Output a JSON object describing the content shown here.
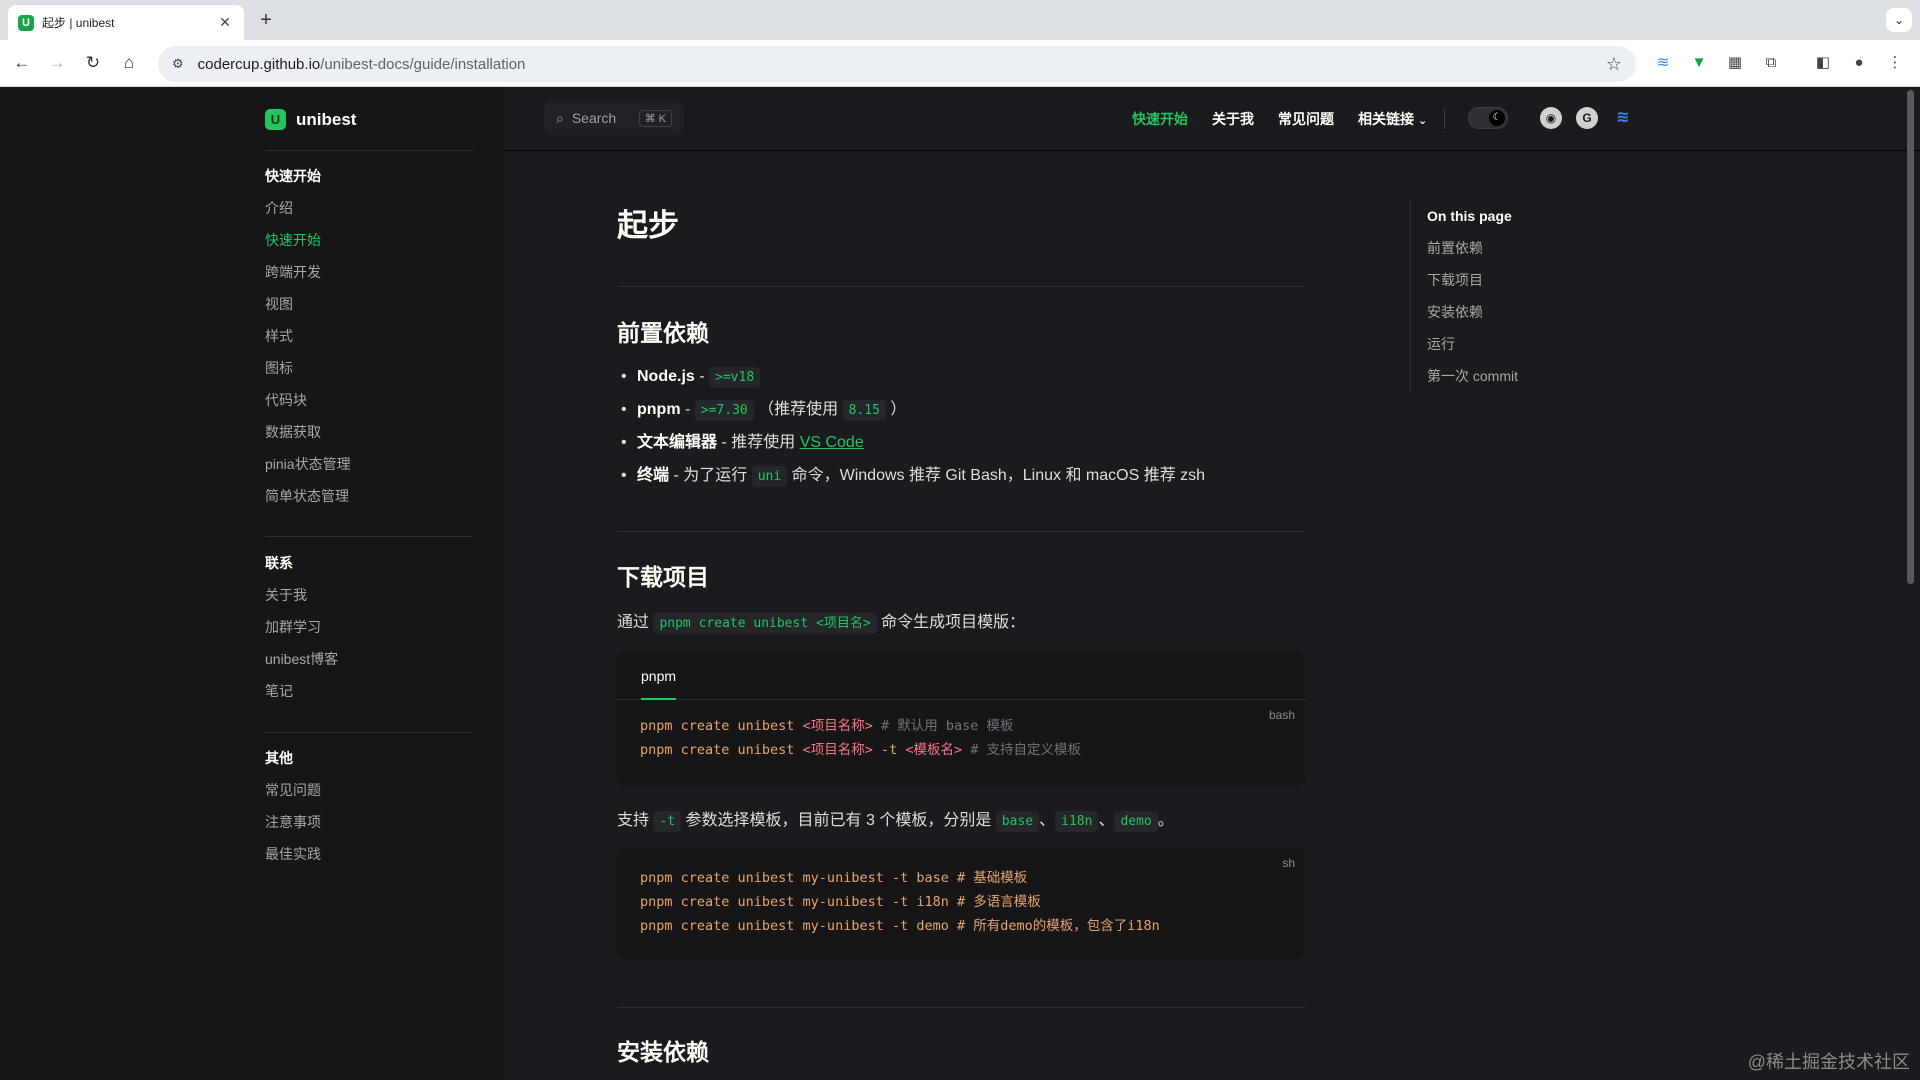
{
  "browser": {
    "tab_title": "起步 | unibest",
    "url_host": "codercup.github.io",
    "url_path": "/unibest-docs/guide/installation"
  },
  "sidebar": {
    "logo": "unibest",
    "groups": [
      {
        "title": "快速开始",
        "items": [
          "介绍",
          "快速开始",
          "跨端开发",
          "视图",
          "样式",
          "图标",
          "代码块",
          "数据获取",
          "pinia状态管理",
          "简单状态管理"
        ]
      },
      {
        "title": "联系",
        "items": [
          "关于我",
          "加群学习",
          "unibest博客",
          "笔记"
        ]
      },
      {
        "title": "其他",
        "items": [
          "常见问题",
          "注意事项",
          "最佳实践"
        ]
      }
    ],
    "active_item": "快速开始"
  },
  "topnav": {
    "search_label": "Search",
    "search_shortcut": "⌘ K",
    "links": [
      "快速开始",
      "关于我",
      "常见问题",
      "相关链接"
    ]
  },
  "main": {
    "title": "起步",
    "sec1": {
      "heading": "前置依赖",
      "b1_name": "Node.js",
      "b1_sep": " - ",
      "b1_code": ">=v18",
      "b2_name": "pnpm",
      "b2_sep": " - ",
      "b2_code": ">=7.30",
      "b2_mid": " （推荐使用 ",
      "b2_code2": "8.15",
      "b2_end": " ）",
      "b3_name": "文本编辑器",
      "b3_mid": " - 推荐使用 ",
      "b3_link": "VS Code",
      "b4_name": "终端",
      "b4_mid": " - 为了运行 ",
      "b4_code": "uni",
      "b4_end": " 命令，Windows 推荐 Git Bash，Linux 和 macOS 推荐 zsh"
    },
    "sec2": {
      "heading": "下载项目",
      "p1_pre": "通过 ",
      "p1_code": "pnpm create unibest <项目名>",
      "p1_post": " 命令生成项目模版：",
      "tab": "pnpm",
      "lang1": "bash",
      "code1_l1_cmd": "pnpm create unibest ",
      "code1_l1_ph": "<项目名称>",
      "code1_l1_cm": " # 默认用 base 模板",
      "code1_l2_cmd": "pnpm create unibest ",
      "code1_l2_ph": "<项目名称>",
      "code1_l2_arg": " -t ",
      "code1_l2_ph2": "<模板名>",
      "code1_l2_cm": " # 支持自定义模板",
      "p2_pre": "支持 ",
      "p2_code": "-t",
      "p2_mid": " 参数选择模板，目前已有 3 个模板，分别是 ",
      "p2_c1": "base",
      "p2_s1": "、",
      "p2_c2": "i18n",
      "p2_s2": "、",
      "p2_c3": "demo",
      "p2_end": "。",
      "lang2": "sh",
      "code2_l1": "pnpm create unibest my-unibest -t base # 基础模板",
      "code2_l2": "pnpm create unibest my-unibest -t i18n # 多语言模板",
      "code2_l3": "pnpm create unibest my-unibest -t demo # 所有demo的模板，包含了i18n"
    },
    "sec3": {
      "heading": "安装依赖"
    }
  },
  "outline": {
    "title": "On this page",
    "items": [
      "前置依赖",
      "下载项目",
      "安装依赖",
      "运行",
      "第一次 commit"
    ]
  },
  "watermark": "@稀土掘金技术社区",
  "colors": {
    "accent": "#22c55e",
    "bg": "#1b1b1f",
    "sidebar_bg": "#161618"
  }
}
